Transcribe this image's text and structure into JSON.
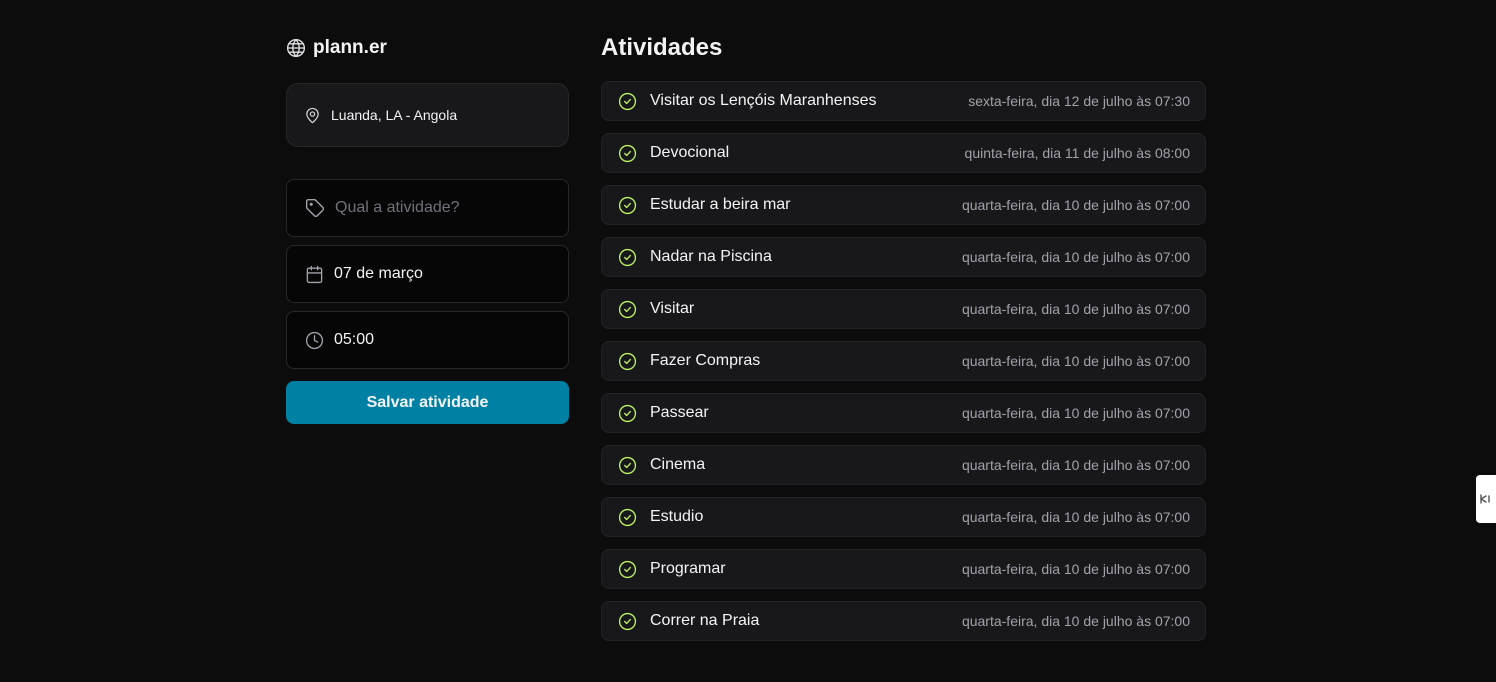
{
  "app": {
    "name": "plann.er"
  },
  "location": {
    "text": "Luanda, LA - Angola"
  },
  "form": {
    "activity_placeholder": "Qual a atividade?",
    "date_value": "07 de março",
    "time_value": "05:00",
    "save_label": "Salvar atividade"
  },
  "activities": {
    "title": "Atividades",
    "items": [
      {
        "name": "Visitar os Lençóis Maranhenses",
        "date": "sexta-feira, dia 12 de julho às 07:30"
      },
      {
        "name": "Devocional",
        "date": "quinta-feira, dia 11 de julho às 08:00"
      },
      {
        "name": "Estudar a beira mar",
        "date": "quarta-feira, dia 10 de julho às 07:00"
      },
      {
        "name": "Nadar na Piscina",
        "date": "quarta-feira, dia 10 de julho às 07:00"
      },
      {
        "name": "Visitar",
        "date": "quarta-feira, dia 10 de julho às 07:00"
      },
      {
        "name": "Fazer Compras",
        "date": "quarta-feira, dia 10 de julho às 07:00"
      },
      {
        "name": "Passear",
        "date": "quarta-feira, dia 10 de julho às 07:00"
      },
      {
        "name": "Cinema",
        "date": "quarta-feira, dia 10 de julho às 07:00"
      },
      {
        "name": "Estudio",
        "date": "quarta-feira, dia 10 de julho às 07:00"
      },
      {
        "name": "Programar",
        "date": "quarta-feira, dia 10 de julho às 07:00"
      },
      {
        "name": "Correr na Praia",
        "date": "quarta-feira, dia 10 de julho às 07:00"
      }
    ]
  },
  "colors": {
    "background": "#0c0c0c",
    "card": "#18181b",
    "accent_button": "#0081a4",
    "check_icon": "#bef264",
    "muted_text": "#a1a1aa"
  },
  "icons": {
    "logo": "globe-icon",
    "location": "map-pin-icon",
    "activity": "tag-icon",
    "date": "calendar-icon",
    "time": "clock-icon",
    "item_status": "circle-check-icon"
  }
}
